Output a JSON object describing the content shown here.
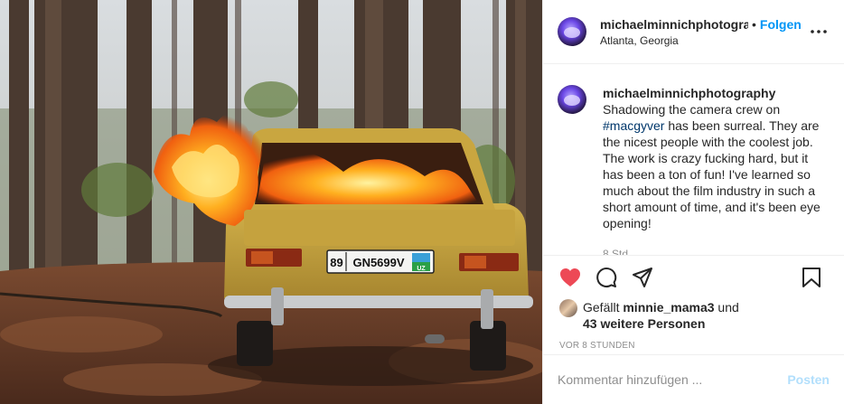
{
  "header": {
    "username": "michaelminnichphotograp",
    "separator": "•",
    "follow_label": "Folgen",
    "location": "Atlanta, Georgia",
    "more_label": "•••"
  },
  "caption": {
    "username": "michaelminnichphotography",
    "text_before": "Shadowing the camera crew on ",
    "hashtag": "#macgyver",
    "text_after": " has been surreal. They are the nicest people with the coolest job. The work is crazy fucking hard, but it has been a ton of fun! I've learned so much about the film industry in such a short amount of time, and it's been eye opening!",
    "time": "8 Std."
  },
  "photo": {
    "license_plate_code": "89",
    "license_plate_number": "GN5699V",
    "license_plate_country": "UZ"
  },
  "actions": {
    "like_icon": "heart-filled-icon",
    "comment_icon": "comment-icon",
    "share_icon": "paper-plane-icon",
    "save_icon": "bookmark-icon",
    "like_color": "#ed4956"
  },
  "likes": {
    "prefix": "Gefällt ",
    "user": "minnie_mama3",
    "conjunction": " und",
    "others": "43 weitere Personen"
  },
  "time_ago": "VOR 8 STUNDEN",
  "comment": {
    "placeholder": "Kommentar hinzufügen ...",
    "post_label": "Posten"
  }
}
